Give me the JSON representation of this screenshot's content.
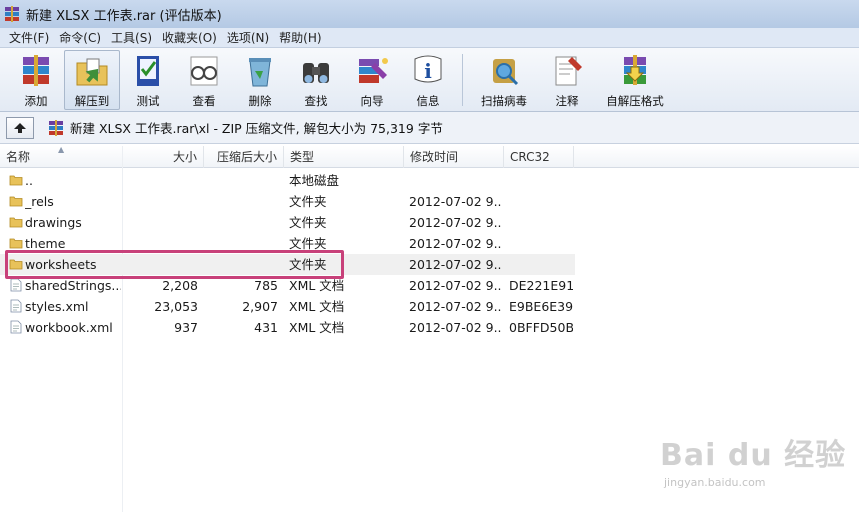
{
  "window": {
    "title": "新建 XLSX 工作表.rar (评估版本)"
  },
  "menu": [
    "文件(F)",
    "命令(C)",
    "工具(S)",
    "收藏夹(O)",
    "选项(N)",
    "帮助(H)"
  ],
  "toolbar": {
    "add": "添加",
    "extract_to": "解压到",
    "test": "测试",
    "view": "查看",
    "delete": "删除",
    "find": "查找",
    "wizard": "向导",
    "info": "信息",
    "virus_scan": "扫描病毒",
    "comment": "注释",
    "sfx": "自解压格式"
  },
  "address": {
    "path": "新建 XLSX 工作表.rar\\xl - ZIP 压缩文件, 解包大小为 75,319 字节"
  },
  "columns": {
    "name": "名称",
    "size": "大小",
    "packed": "压缩后大小",
    "type": "类型",
    "modified": "修改时间",
    "crc": "CRC32"
  },
  "files": [
    {
      "name": "..",
      "size": "",
      "packed": "",
      "type": "本地磁盘",
      "modified": "",
      "crc": "",
      "icon": "folder"
    },
    {
      "name": "_rels",
      "size": "",
      "packed": "",
      "type": "文件夹",
      "modified": "2012-07-02 9...",
      "crc": "",
      "icon": "folder"
    },
    {
      "name": "drawings",
      "size": "",
      "packed": "",
      "type": "文件夹",
      "modified": "2012-07-02 9...",
      "crc": "",
      "icon": "folder"
    },
    {
      "name": "theme",
      "size": "",
      "packed": "",
      "type": "文件夹",
      "modified": "2012-07-02 9...",
      "crc": "",
      "icon": "folder"
    },
    {
      "name": "worksheets",
      "size": "",
      "packed": "",
      "type": "文件夹",
      "modified": "2012-07-02 9...",
      "crc": "",
      "icon": "folder"
    },
    {
      "name": "sharedStrings....",
      "size": "2,208",
      "packed": "785",
      "type": "XML 文档",
      "modified": "2012-07-02 9...",
      "crc": "DE221E91",
      "icon": "xml"
    },
    {
      "name": "styles.xml",
      "size": "23,053",
      "packed": "2,907",
      "type": "XML 文档",
      "modified": "2012-07-02 9...",
      "crc": "E9BE6E39",
      "icon": "xml"
    },
    {
      "name": "workbook.xml",
      "size": "937",
      "packed": "431",
      "type": "XML 文档",
      "modified": "2012-07-02 9...",
      "crc": "0BFFD50B",
      "icon": "xml"
    }
  ],
  "selected_row": 4,
  "watermark": {
    "logo": "Bai du 经验",
    "sub": "jingyan.baidu.com"
  },
  "colors": {
    "highlight": "#c8417a",
    "folder": "#e8c25a"
  }
}
